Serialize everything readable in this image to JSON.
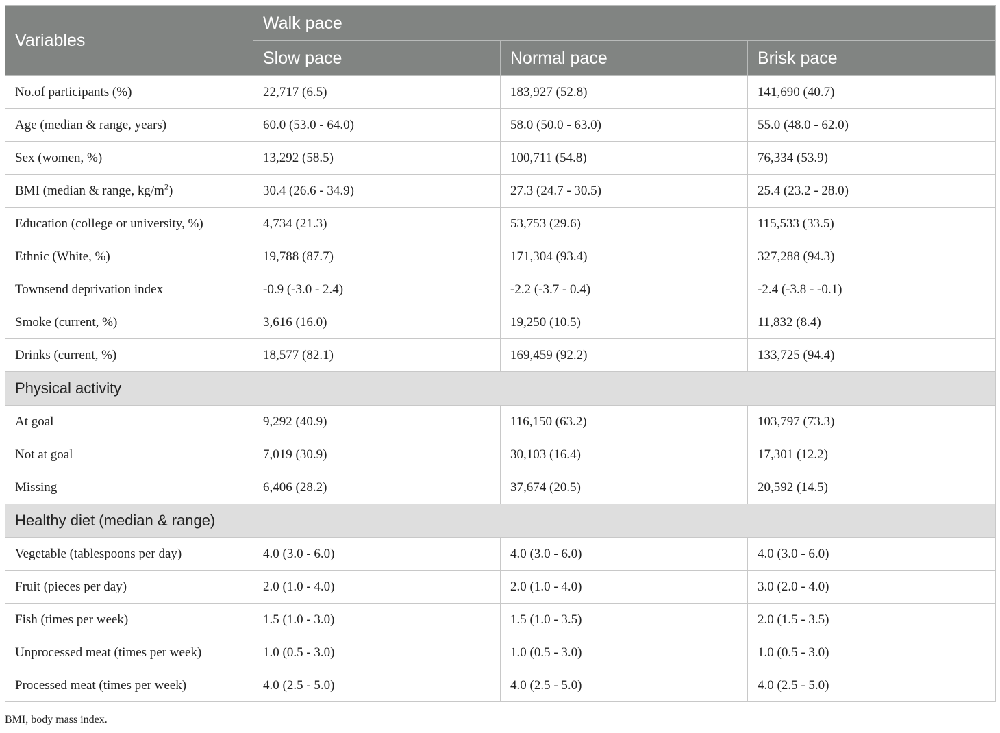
{
  "header": {
    "variables": "Variables",
    "group": "Walk pace",
    "columns": [
      "Slow pace",
      "Normal pace",
      "Brisk pace"
    ]
  },
  "rows": [
    {
      "label": "No.of participants (%)",
      "values": [
        "22,717 (6.5)",
        "183,927 (52.8)",
        "141,690 (40.7)"
      ]
    },
    {
      "label": "Age (median & range, years)",
      "values": [
        "60.0 (53.0 - 64.0)",
        "58.0 (50.0 - 63.0)",
        "55.0 (48.0 - 62.0)"
      ]
    },
    {
      "label": "Sex (women, %)",
      "values": [
        "13,292 (58.5)",
        "100,711 (54.8)",
        "76,334 (53.9)"
      ]
    },
    {
      "label_pre": "BMI (median & range, kg/m",
      "label_sup": "2",
      "label_post": ")",
      "values": [
        "30.4 (26.6 - 34.9)",
        "27.3 (24.7 - 30.5)",
        "25.4 (23.2 - 28.0)"
      ]
    },
    {
      "label": "Education (college or university, %)",
      "values": [
        "4,734 (21.3)",
        "53,753 (29.6)",
        "115,533 (33.5)"
      ]
    },
    {
      "label": "Ethnic (White, %)",
      "values": [
        "19,788 (87.7)",
        "171,304 (93.4)",
        "327,288 (94.3)"
      ]
    },
    {
      "label": "Townsend deprivation index",
      "values": [
        "-0.9 (-3.0 - 2.4)",
        "-2.2 (-3.7 - 0.4)",
        "-2.4 (-3.8 - -0.1)"
      ]
    },
    {
      "label": "Smoke (current, %)",
      "values": [
        "3,616 (16.0)",
        "19,250 (10.5)",
        "11,832 (8.4)"
      ]
    },
    {
      "label": "Drinks (current, %)",
      "values": [
        "18,577 (82.1)",
        "169,459 (92.2)",
        "133,725 (94.4)"
      ]
    }
  ],
  "sections": [
    {
      "title": "Physical activity",
      "rows": [
        {
          "label": "At goal",
          "values": [
            "9,292 (40.9)",
            "116,150 (63.2)",
            "103,797 (73.3)"
          ]
        },
        {
          "label": "Not at goal",
          "values": [
            "7,019 (30.9)",
            "30,103 (16.4)",
            "17,301 (12.2)"
          ]
        },
        {
          "label": "Missing",
          "values": [
            "6,406 (28.2)",
            "37,674 (20.5)",
            "20,592 (14.5)"
          ]
        }
      ]
    },
    {
      "title": "Healthy diet (median & range)",
      "rows": [
        {
          "label": "Vegetable (tablespoons per day)",
          "values": [
            "4.0 (3.0 - 6.0)",
            "4.0 (3.0 - 6.0)",
            "4.0 (3.0 - 6.0)"
          ]
        },
        {
          "label": "Fruit (pieces per day)",
          "values": [
            "2.0 (1.0 - 4.0)",
            "2.0 (1.0 - 4.0)",
            "3.0 (2.0 - 4.0)"
          ]
        },
        {
          "label": "Fish (times per week)",
          "values": [
            "1.5 (1.0 - 3.0)",
            "1.5 (1.0 - 3.5)",
            "2.0 (1.5 - 3.5)"
          ]
        },
        {
          "label": "Unprocessed meat (times per week)",
          "values": [
            "1.0 (0.5 - 3.0)",
            "1.0 (0.5 - 3.0)",
            "1.0 (0.5 - 3.0)"
          ]
        },
        {
          "label": "Processed meat (times per week)",
          "values": [
            "4.0 (2.5 - 5.0)",
            "4.0 (2.5 - 5.0)",
            "4.0 (2.5 - 5.0)"
          ]
        }
      ]
    }
  ],
  "footnote": "BMI, body mass index."
}
